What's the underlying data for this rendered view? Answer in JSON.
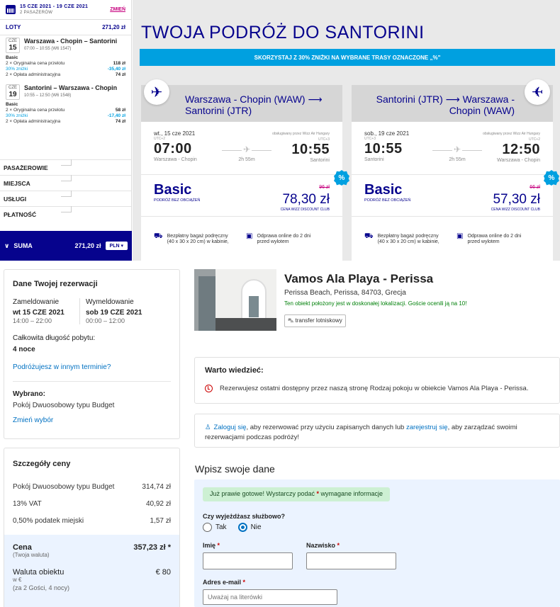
{
  "wizz": {
    "sidebar": {
      "dates": "15 CZE 2021 - 19 CZE 2021",
      "pax": "2 PASAŻERÓW",
      "change": "ZMIEŃ",
      "flights_label": "LOTY",
      "flights_total": "271,20 zł",
      "outbound": {
        "month": "CZE",
        "day": "15",
        "route": "Warszawa - Chopin – Santorini",
        "time": "07:00 – 10:55 (W6 1547)",
        "fare_name": "Basic",
        "l1": "2 × Oryginalna cena przelotu",
        "v1": "118 zł",
        "l2": "30% zniżki",
        "v2": "-35,40 zł",
        "l3": "2 × Opłata administracyjna",
        "v3": "74 zł"
      },
      "inbound": {
        "month": "CZE",
        "day": "19",
        "route": "Santorini – Warszawa - Chopin",
        "time": "10:55 – 12:50 (W6 1548)",
        "fare_name": "Basic",
        "l1": "2 × Oryginalna cena przelotu",
        "v1": "58 zł",
        "l2": "30% zniżki",
        "v2": "-17,40 zł",
        "l3": "2 × Opłata administracyjna",
        "v3": "74 zł"
      },
      "sections": [
        "PASAŻEROWIE",
        "MIEJSCA",
        "USŁUGI",
        "PŁATNOŚĆ"
      ],
      "sum_label": "SUMA",
      "sum_value": "271,20 zł",
      "currency": "PLN ▾"
    },
    "title": "TWOJA PODRÓŻ DO SANTORINI",
    "banner": "SKORZYSTAJ Z 30% ZNIŻKI NA WYBRANE TRASY OZNACZONE „%\"",
    "cards": [
      {
        "route": "Warszawa - Chopin (WAW) ⟶ Santorini (JTR)",
        "date": "wt., 15 cze 2021",
        "operated": "obsługiwany przez Wizz Air Hungary",
        "tz1": "UTC+2",
        "dep": "07:00",
        "tz2": "UTC+3",
        "arr": "10:55",
        "from": "Warszawa - Chopin",
        "to": "Santorini",
        "duration": "2h 55m",
        "fare": "Basic",
        "fare_sub": "PODRÓŻ BEZ OBCIĄŻEŃ",
        "old": "96 zł",
        "price": "78,30 zł",
        "club": "CENA WIZZ DISCOUNT CLUB",
        "b1": "Bezpłatny bagaż podręczny (40 x 30 x 20 cm) w kabinie,",
        "b2": "Odprawa online do 2 dni przed wylotem",
        "pct": "%"
      },
      {
        "route": "Santorini (JTR) ⟶ Warszawa - Chopin (WAW)",
        "date": "sob., 19 cze 2021",
        "operated": "obsługiwany przez Wizz Air Hungary",
        "tz1": "UTC+3",
        "dep": "10:55",
        "tz2": "UTC+2",
        "arr": "12:50",
        "from": "Santorini",
        "to": "Warszawa - Chopin",
        "duration": "2h 55m",
        "fare": "Basic",
        "fare_sub": "PODRÓŻ BEZ OBCIĄŻEŃ",
        "old": "66 zł",
        "price": "57,30 zł",
        "club": "CENA WIZZ DISCOUNT CLUB",
        "b1": "Bezpłatny bagaż podręczny (40 x 30 x 20 cm) w kabinie,",
        "b2": "Odprawa online do 2 dni przed wylotem",
        "pct": "%"
      }
    ]
  },
  "booking": {
    "reservation": {
      "title": "Dane Twojej rezerwacji",
      "checkin_label": "Zameldowanie",
      "checkin_date": "wt 15 CZE 2021",
      "checkin_hours": "14:00 – 22:00",
      "checkout_label": "Wymeldowanie",
      "checkout_date": "sob 19 CZE 2021",
      "checkout_hours": "00:00 – 12:00",
      "length_label": "Całkowita długość pobytu:",
      "length_value": "4 noce",
      "other_dates": "Podróżujesz w innym terminie?",
      "chosen_label": "Wybrano:",
      "chosen_value": "Pokój Dwuosobowy typu Budget",
      "change_choice": "Zmień wybór"
    },
    "price": {
      "title": "Szczegóły ceny",
      "rows": [
        {
          "label": "Pokój Dwuosobowy typu Budget",
          "value": "314,74 zł"
        },
        {
          "label": "13% VAT",
          "value": "40,92 zł"
        },
        {
          "label": "0,50% podatek miejski",
          "value": "1,57 zł"
        }
      ],
      "total_label": "Cena",
      "total_value": "357,23 zł *",
      "total_sub": "(Twoja waluta)",
      "prop_label": "Waluta obiektu",
      "prop_value": "€ 80",
      "prop_sub": "w €",
      "prop_sub2": "(za 2 Gości,  4 nocy)"
    },
    "hotel": {
      "name": "Vamos Ala Playa - Perissa",
      "address": "Perissa Beach, Perissa, 84703, Grecja",
      "location_note": "Ten obiekt położony jest w doskonałej lokalizacji. Goście ocenili ją na 10!",
      "transfer": "transfer lotniskowy"
    },
    "know": {
      "title": "Warto wiedzieć:",
      "text": "Rezerwujesz ostatni dostępny przez naszą stronę Rodzaj pokoju w obiekcie Vamos Ala Playa - Perissa."
    },
    "login": {
      "login_link": "Zaloguj się",
      "text1": ", aby rezerwować przy użyciu zapisanych danych lub ",
      "register_link": "zarejestruj się",
      "text2": ", aby zarządzać swoimi rezerwacjami podczas podróży!"
    },
    "form": {
      "title": "Wpisz swoje dane",
      "ok_text1": "Już prawie gotowe! Wystarczy podać ",
      "ok_star": "*",
      "ok_text2": " wymagane informacje",
      "business_q": "Czy wyjeżdżasz służbowo?",
      "yes": "Tak",
      "no": "Nie",
      "first_label": "Imię",
      "last_label": "Nazwisko",
      "email_label": "Adres e-mail",
      "star": "*",
      "email_placeholder": "Uważaj na literówki"
    }
  }
}
